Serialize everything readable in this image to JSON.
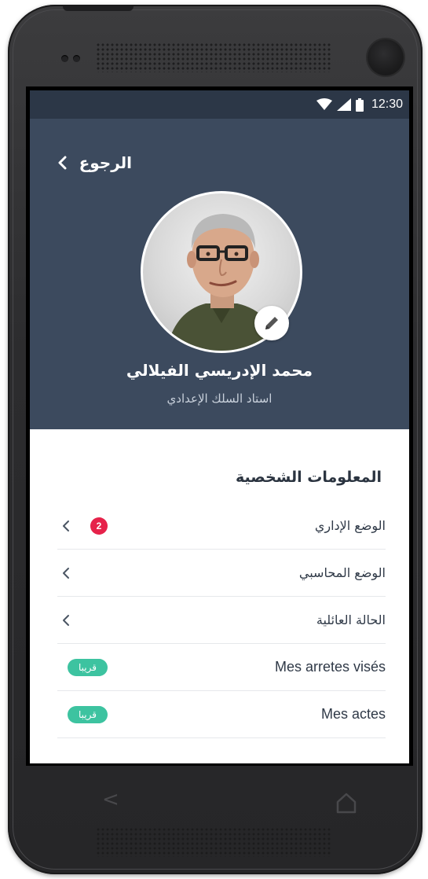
{
  "status_bar": {
    "time": "12:30"
  },
  "header": {
    "back_label": "الرجوع",
    "background_color": "#3c4a5e",
    "status_bar_color": "#2c3747"
  },
  "profile": {
    "name": "محمد الإدريسي الفيلالي",
    "title": "استاد السلك الإعدادي"
  },
  "section": {
    "title": "المعلومات الشخصية"
  },
  "menu": {
    "items": [
      {
        "label": "الوضع الإداري",
        "badge_count": "2",
        "icon": "chevron-left-icon"
      },
      {
        "label": "الوضع المحاسبي",
        "icon": "chevron-left-icon"
      },
      {
        "label": "الحالة العائلية",
        "icon": "chevron-left-icon"
      },
      {
        "label": "Mes arretes visés",
        "soon_label": "قريبا"
      },
      {
        "label": "Mes actes",
        "soon_label": "قريبا"
      }
    ]
  },
  "colors": {
    "badge_red": "#e6224a",
    "soon_green": "#3dc3a0",
    "text_dark": "#2f3947"
  }
}
